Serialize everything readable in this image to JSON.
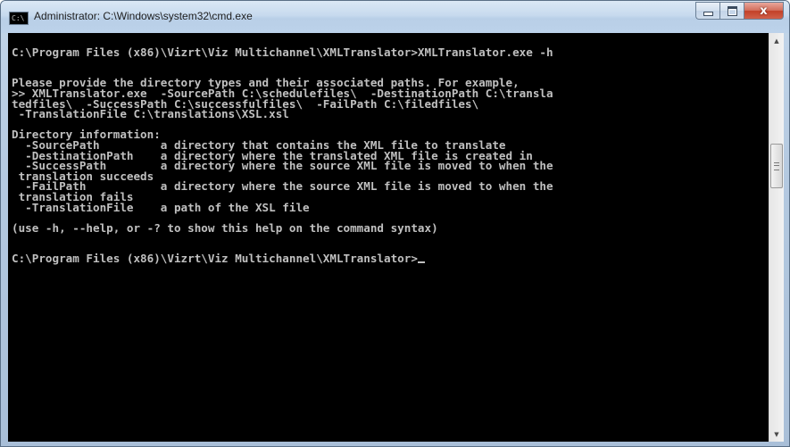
{
  "window": {
    "title": "Administrator: C:\\Windows\\system32\\cmd.exe",
    "icon_label": "C:\\",
    "icon": "cmd-icon",
    "buttons": {
      "minimize": "minimize-icon",
      "maximize": "maximize-icon",
      "close": "close-icon",
      "close_glyph": "x"
    }
  },
  "console": {
    "background": "#000000",
    "foreground": "#c0c0c0",
    "lines": [
      "",
      "C:\\Program Files (x86)\\Vizrt\\Viz Multichannel\\XMLTranslator>XMLTranslator.exe -h",
      "",
      "",
      "Please provide the directory types and their associated paths. For example,",
      ">> XMLTranslator.exe  -SourcePath C:\\schedulefiles\\  -DestinationPath C:\\transla",
      "tedfiles\\  -SuccessPath C:\\successfulfiles\\  -FailPath C:\\filedfiles\\",
      " -TranslationFile C:\\translations\\XSL.xsl",
      "",
      "Directory information:",
      "  -SourcePath         a directory that contains the XML file to translate",
      "  -DestinationPath    a directory where the translated XML file is created in",
      "  -SuccessPath        a directory where the source XML file is moved to when the",
      " translation succeeds",
      "  -FailPath           a directory where the source XML file is moved to when the",
      " translation fails",
      "  -TranslationFile    a path of the XSL file",
      "",
      "(use -h, --help, or -? to show this help on the command syntax)",
      "",
      "",
      "C:\\Program Files (x86)\\Vizrt\\Viz Multichannel\\XMLTranslator>"
    ]
  },
  "scrollbar": {
    "up_arrow": "▲",
    "down_arrow": "▼"
  }
}
